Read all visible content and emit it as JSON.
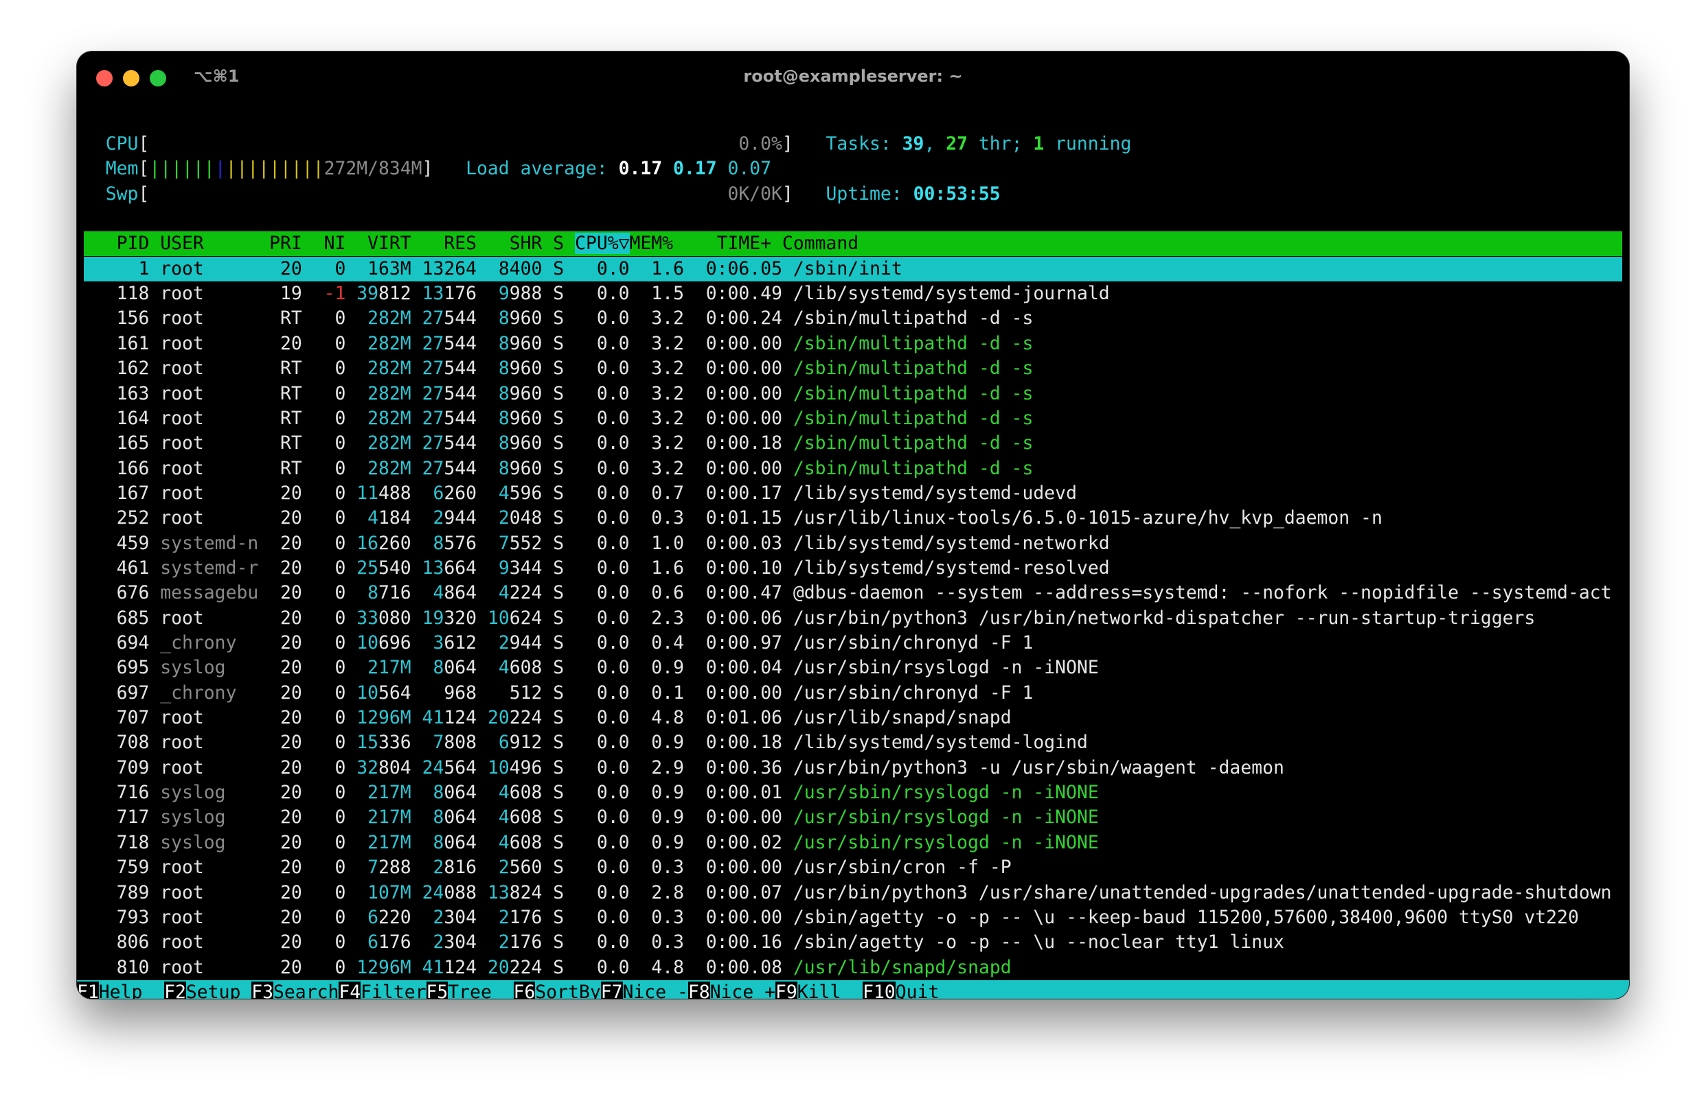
{
  "window": {
    "title": "root@exampleserver: ~",
    "shortcut": "⌥⌘1",
    "lights": {
      "close": "#fe5f57",
      "minimize": "#febc2e",
      "zoom": "#28c840"
    }
  },
  "meters": {
    "cpu": {
      "label": "CPU",
      "value": "0.0%",
      "fraction": 0.0
    },
    "mem": {
      "label": "Mem",
      "value": "272M/834M",
      "fraction": 0.326
    },
    "swp": {
      "label": "Swp",
      "value": "0K/0K",
      "fraction": 0.0
    }
  },
  "stats": {
    "tasks_label": "Tasks:",
    "tasks": "39",
    "threads": "27",
    "thr_label": "thr;",
    "running": "1",
    "running_label": "running",
    "load_label": "Load average:",
    "load1": "0.17",
    "load5": "0.17",
    "load15": "0.07",
    "uptime_label": "Uptime:",
    "uptime": "00:53:55"
  },
  "columns": [
    "PID",
    "USER",
    "PRI",
    "NI",
    "VIRT",
    "RES",
    "SHR",
    "S",
    "CPU%▽",
    "MEM%",
    "TIME+",
    "Command"
  ],
  "sort_column": "CPU%▽",
  "processes": [
    {
      "pid": "1",
      "user": "root",
      "pri": "20",
      "ni": "0",
      "virt": "163M",
      "res": "13264",
      "shr": "8400",
      "s": "S",
      "cpu": "0.0",
      "mem": "1.6",
      "time": "0:06.05",
      "cmd": "/sbin/init",
      "thread": false,
      "selected": true
    },
    {
      "pid": "118",
      "user": "root",
      "pri": "19",
      "ni": "-1",
      "virt": "39812",
      "res": "13176",
      "shr": "9988",
      "s": "S",
      "cpu": "0.0",
      "mem": "1.5",
      "time": "0:00.49",
      "cmd": "/lib/systemd/systemd-journald",
      "thread": false,
      "selected": false
    },
    {
      "pid": "156",
      "user": "root",
      "pri": "RT",
      "ni": "0",
      "virt": "282M",
      "res": "27544",
      "shr": "8960",
      "s": "S",
      "cpu": "0.0",
      "mem": "3.2",
      "time": "0:00.24",
      "cmd": "/sbin/multipathd -d -s",
      "thread": false,
      "selected": false
    },
    {
      "pid": "161",
      "user": "root",
      "pri": "20",
      "ni": "0",
      "virt": "282M",
      "res": "27544",
      "shr": "8960",
      "s": "S",
      "cpu": "0.0",
      "mem": "3.2",
      "time": "0:00.00",
      "cmd": "/sbin/multipathd -d -s",
      "thread": true,
      "selected": false
    },
    {
      "pid": "162",
      "user": "root",
      "pri": "RT",
      "ni": "0",
      "virt": "282M",
      "res": "27544",
      "shr": "8960",
      "s": "S",
      "cpu": "0.0",
      "mem": "3.2",
      "time": "0:00.00",
      "cmd": "/sbin/multipathd -d -s",
      "thread": true,
      "selected": false
    },
    {
      "pid": "163",
      "user": "root",
      "pri": "RT",
      "ni": "0",
      "virt": "282M",
      "res": "27544",
      "shr": "8960",
      "s": "S",
      "cpu": "0.0",
      "mem": "3.2",
      "time": "0:00.00",
      "cmd": "/sbin/multipathd -d -s",
      "thread": true,
      "selected": false
    },
    {
      "pid": "164",
      "user": "root",
      "pri": "RT",
      "ni": "0",
      "virt": "282M",
      "res": "27544",
      "shr": "8960",
      "s": "S",
      "cpu": "0.0",
      "mem": "3.2",
      "time": "0:00.00",
      "cmd": "/sbin/multipathd -d -s",
      "thread": true,
      "selected": false
    },
    {
      "pid": "165",
      "user": "root",
      "pri": "RT",
      "ni": "0",
      "virt": "282M",
      "res": "27544",
      "shr": "8960",
      "s": "S",
      "cpu": "0.0",
      "mem": "3.2",
      "time": "0:00.18",
      "cmd": "/sbin/multipathd -d -s",
      "thread": true,
      "selected": false
    },
    {
      "pid": "166",
      "user": "root",
      "pri": "RT",
      "ni": "0",
      "virt": "282M",
      "res": "27544",
      "shr": "8960",
      "s": "S",
      "cpu": "0.0",
      "mem": "3.2",
      "time": "0:00.00",
      "cmd": "/sbin/multipathd -d -s",
      "thread": true,
      "selected": false
    },
    {
      "pid": "167",
      "user": "root",
      "pri": "20",
      "ni": "0",
      "virt": "11488",
      "res": "6260",
      "shr": "4596",
      "s": "S",
      "cpu": "0.0",
      "mem": "0.7",
      "time": "0:00.17",
      "cmd": "/lib/systemd/systemd-udevd",
      "thread": false,
      "selected": false
    },
    {
      "pid": "252",
      "user": "root",
      "pri": "20",
      "ni": "0",
      "virt": "4184",
      "res": "2944",
      "shr": "2048",
      "s": "S",
      "cpu": "0.0",
      "mem": "0.3",
      "time": "0:01.15",
      "cmd": "/usr/lib/linux-tools/6.5.0-1015-azure/hv_kvp_daemon -n",
      "thread": false,
      "selected": false
    },
    {
      "pid": "459",
      "user": "systemd-n",
      "pri": "20",
      "ni": "0",
      "virt": "16260",
      "res": "8576",
      "shr": "7552",
      "s": "S",
      "cpu": "0.0",
      "mem": "1.0",
      "time": "0:00.03",
      "cmd": "/lib/systemd/systemd-networkd",
      "thread": false,
      "selected": false
    },
    {
      "pid": "461",
      "user": "systemd-r",
      "pri": "20",
      "ni": "0",
      "virt": "25540",
      "res": "13664",
      "shr": "9344",
      "s": "S",
      "cpu": "0.0",
      "mem": "1.6",
      "time": "0:00.10",
      "cmd": "/lib/systemd/systemd-resolved",
      "thread": false,
      "selected": false
    },
    {
      "pid": "676",
      "user": "messagebu",
      "pri": "20",
      "ni": "0",
      "virt": "8716",
      "res": "4864",
      "shr": "4224",
      "s": "S",
      "cpu": "0.0",
      "mem": "0.6",
      "time": "0:00.47",
      "cmd": "@dbus-daemon --system --address=systemd: --nofork --nopidfile --systemd-act",
      "thread": false,
      "selected": false
    },
    {
      "pid": "685",
      "user": "root",
      "pri": "20",
      "ni": "0",
      "virt": "33080",
      "res": "19320",
      "shr": "10624",
      "s": "S",
      "cpu": "0.0",
      "mem": "2.3",
      "time": "0:00.06",
      "cmd": "/usr/bin/python3 /usr/bin/networkd-dispatcher --run-startup-triggers",
      "thread": false,
      "selected": false
    },
    {
      "pid": "694",
      "user": "_chrony",
      "pri": "20",
      "ni": "0",
      "virt": "10696",
      "res": "3612",
      "shr": "2944",
      "s": "S",
      "cpu": "0.0",
      "mem": "0.4",
      "time": "0:00.97",
      "cmd": "/usr/sbin/chronyd -F 1",
      "thread": false,
      "selected": false
    },
    {
      "pid": "695",
      "user": "syslog",
      "pri": "20",
      "ni": "0",
      "virt": "217M",
      "res": "8064",
      "shr": "4608",
      "s": "S",
      "cpu": "0.0",
      "mem": "0.9",
      "time": "0:00.04",
      "cmd": "/usr/sbin/rsyslogd -n -iNONE",
      "thread": false,
      "selected": false
    },
    {
      "pid": "697",
      "user": "_chrony",
      "pri": "20",
      "ni": "0",
      "virt": "10564",
      "res": "968",
      "shr": "512",
      "s": "S",
      "cpu": "0.0",
      "mem": "0.1",
      "time": "0:00.00",
      "cmd": "/usr/sbin/chronyd -F 1",
      "thread": false,
      "selected": false
    },
    {
      "pid": "707",
      "user": "root",
      "pri": "20",
      "ni": "0",
      "virt": "1296M",
      "res": "41124",
      "shr": "20224",
      "s": "S",
      "cpu": "0.0",
      "mem": "4.8",
      "time": "0:01.06",
      "cmd": "/usr/lib/snapd/snapd",
      "thread": false,
      "selected": false
    },
    {
      "pid": "708",
      "user": "root",
      "pri": "20",
      "ni": "0",
      "virt": "15336",
      "res": "7808",
      "shr": "6912",
      "s": "S",
      "cpu": "0.0",
      "mem": "0.9",
      "time": "0:00.18",
      "cmd": "/lib/systemd/systemd-logind",
      "thread": false,
      "selected": false
    },
    {
      "pid": "709",
      "user": "root",
      "pri": "20",
      "ni": "0",
      "virt": "32804",
      "res": "24564",
      "shr": "10496",
      "s": "S",
      "cpu": "0.0",
      "mem": "2.9",
      "time": "0:00.36",
      "cmd": "/usr/bin/python3 -u /usr/sbin/waagent -daemon",
      "thread": false,
      "selected": false
    },
    {
      "pid": "716",
      "user": "syslog",
      "pri": "20",
      "ni": "0",
      "virt": "217M",
      "res": "8064",
      "shr": "4608",
      "s": "S",
      "cpu": "0.0",
      "mem": "0.9",
      "time": "0:00.01",
      "cmd": "/usr/sbin/rsyslogd -n -iNONE",
      "thread": true,
      "selected": false
    },
    {
      "pid": "717",
      "user": "syslog",
      "pri": "20",
      "ni": "0",
      "virt": "217M",
      "res": "8064",
      "shr": "4608",
      "s": "S",
      "cpu": "0.0",
      "mem": "0.9",
      "time": "0:00.00",
      "cmd": "/usr/sbin/rsyslogd -n -iNONE",
      "thread": true,
      "selected": false
    },
    {
      "pid": "718",
      "user": "syslog",
      "pri": "20",
      "ni": "0",
      "virt": "217M",
      "res": "8064",
      "shr": "4608",
      "s": "S",
      "cpu": "0.0",
      "mem": "0.9",
      "time": "0:00.02",
      "cmd": "/usr/sbin/rsyslogd -n -iNONE",
      "thread": true,
      "selected": false
    },
    {
      "pid": "759",
      "user": "root",
      "pri": "20",
      "ni": "0",
      "virt": "7288",
      "res": "2816",
      "shr": "2560",
      "s": "S",
      "cpu": "0.0",
      "mem": "0.3",
      "time": "0:00.00",
      "cmd": "/usr/sbin/cron -f -P",
      "thread": false,
      "selected": false
    },
    {
      "pid": "789",
      "user": "root",
      "pri": "20",
      "ni": "0",
      "virt": "107M",
      "res": "24088",
      "shr": "13824",
      "s": "S",
      "cpu": "0.0",
      "mem": "2.8",
      "time": "0:00.07",
      "cmd": "/usr/bin/python3 /usr/share/unattended-upgrades/unattended-upgrade-shutdown",
      "thread": false,
      "selected": false
    },
    {
      "pid": "793",
      "user": "root",
      "pri": "20",
      "ni": "0",
      "virt": "6220",
      "res": "2304",
      "shr": "2176",
      "s": "S",
      "cpu": "0.0",
      "mem": "0.3",
      "time": "0:00.00",
      "cmd": "/sbin/agetty -o -p -- \\u --keep-baud 115200,57600,38400,9600 ttyS0 vt220",
      "thread": false,
      "selected": false
    },
    {
      "pid": "806",
      "user": "root",
      "pri": "20",
      "ni": "0",
      "virt": "6176",
      "res": "2304",
      "shr": "2176",
      "s": "S",
      "cpu": "0.0",
      "mem": "0.3",
      "time": "0:00.16",
      "cmd": "/sbin/agetty -o -p -- \\u --noclear tty1 linux",
      "thread": false,
      "selected": false
    },
    {
      "pid": "810",
      "user": "root",
      "pri": "20",
      "ni": "0",
      "virt": "1296M",
      "res": "41124",
      "shr": "20224",
      "s": "S",
      "cpu": "0.0",
      "mem": "4.8",
      "time": "0:00.08",
      "cmd": "/usr/lib/snapd/snapd",
      "thread": true,
      "selected": false
    }
  ],
  "function_keys": [
    {
      "key": "F1",
      "label": "Help"
    },
    {
      "key": "F2",
      "label": "Setup"
    },
    {
      "key": "F3",
      "label": "Search"
    },
    {
      "key": "F4",
      "label": "Filter"
    },
    {
      "key": "F5",
      "label": "Tree"
    },
    {
      "key": "F6",
      "label": "SortBy"
    },
    {
      "key": "F7",
      "label": "Nice -"
    },
    {
      "key": "F8",
      "label": "Nice +"
    },
    {
      "key": "F9",
      "label": "Kill"
    },
    {
      "key": "F10",
      "label": "Quit"
    }
  ]
}
